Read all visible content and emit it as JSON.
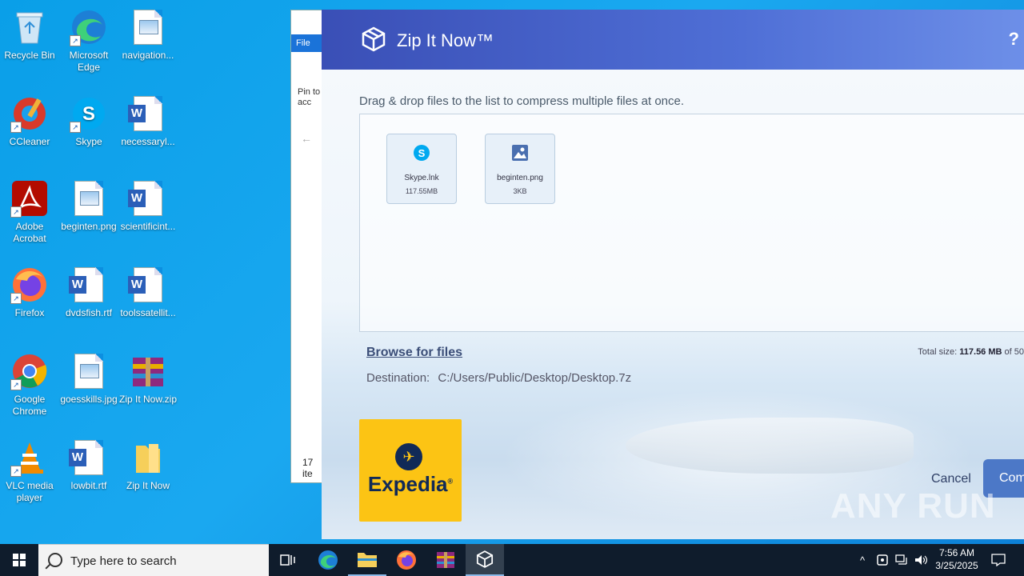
{
  "desktop": {
    "icons": [
      {
        "label": "Recycle Bin"
      },
      {
        "label": "Microsoft Edge"
      },
      {
        "label": "navigation..."
      },
      {
        "label": "CCleaner"
      },
      {
        "label": "Skype"
      },
      {
        "label": "necessaryl..."
      },
      {
        "label": "Adobe Acrobat"
      },
      {
        "label": "beginten.png"
      },
      {
        "label": "scientificint..."
      },
      {
        "label": "Firefox"
      },
      {
        "label": "dvdsfish.rtf"
      },
      {
        "label": "toolssatellit..."
      },
      {
        "label": "Google Chrome"
      },
      {
        "label": "goesskills.jpg"
      },
      {
        "label": "Zip It Now.zip"
      },
      {
        "label": "VLC media player"
      },
      {
        "label": "lowbit.rtf"
      },
      {
        "label": "Zip It Now"
      }
    ]
  },
  "explorer": {
    "file_tab": "File",
    "pin_label": "Pin to acc",
    "item_count": "17 ite"
  },
  "zip": {
    "title": "Zip It Now™",
    "help": "?",
    "hint": "Drag & drop files to the list to compress multiple files at once.",
    "files": [
      {
        "name": "Skype.lnk",
        "size": "117.55MB",
        "icon": "skype-icon"
      },
      {
        "name": "beginten.png",
        "size": "3KB",
        "icon": "image-file-icon"
      }
    ],
    "browse": "Browse for files",
    "total_label": "Total size:",
    "total_value": "117.56 MB",
    "total_suffix": "of 50",
    "destination_label": "Destination:",
    "destination_path": "C:/Users/Public/Desktop/Desktop.7z",
    "ad_brand": "Expedia",
    "cancel": "Cancel",
    "confirm": "Com"
  },
  "watermark": "ANY RUN",
  "taskbar": {
    "search_placeholder": "Type here to search",
    "time": "7:56 AM",
    "date": "3/25/2025"
  },
  "colors": {
    "desktop": "#0a9fe8",
    "titlebar": "#3a4fb6",
    "confirm": "#4c78c7",
    "ad_bg": "#fcc414",
    "ad_fg": "#112a57",
    "taskbar": "#0f1c2c"
  }
}
